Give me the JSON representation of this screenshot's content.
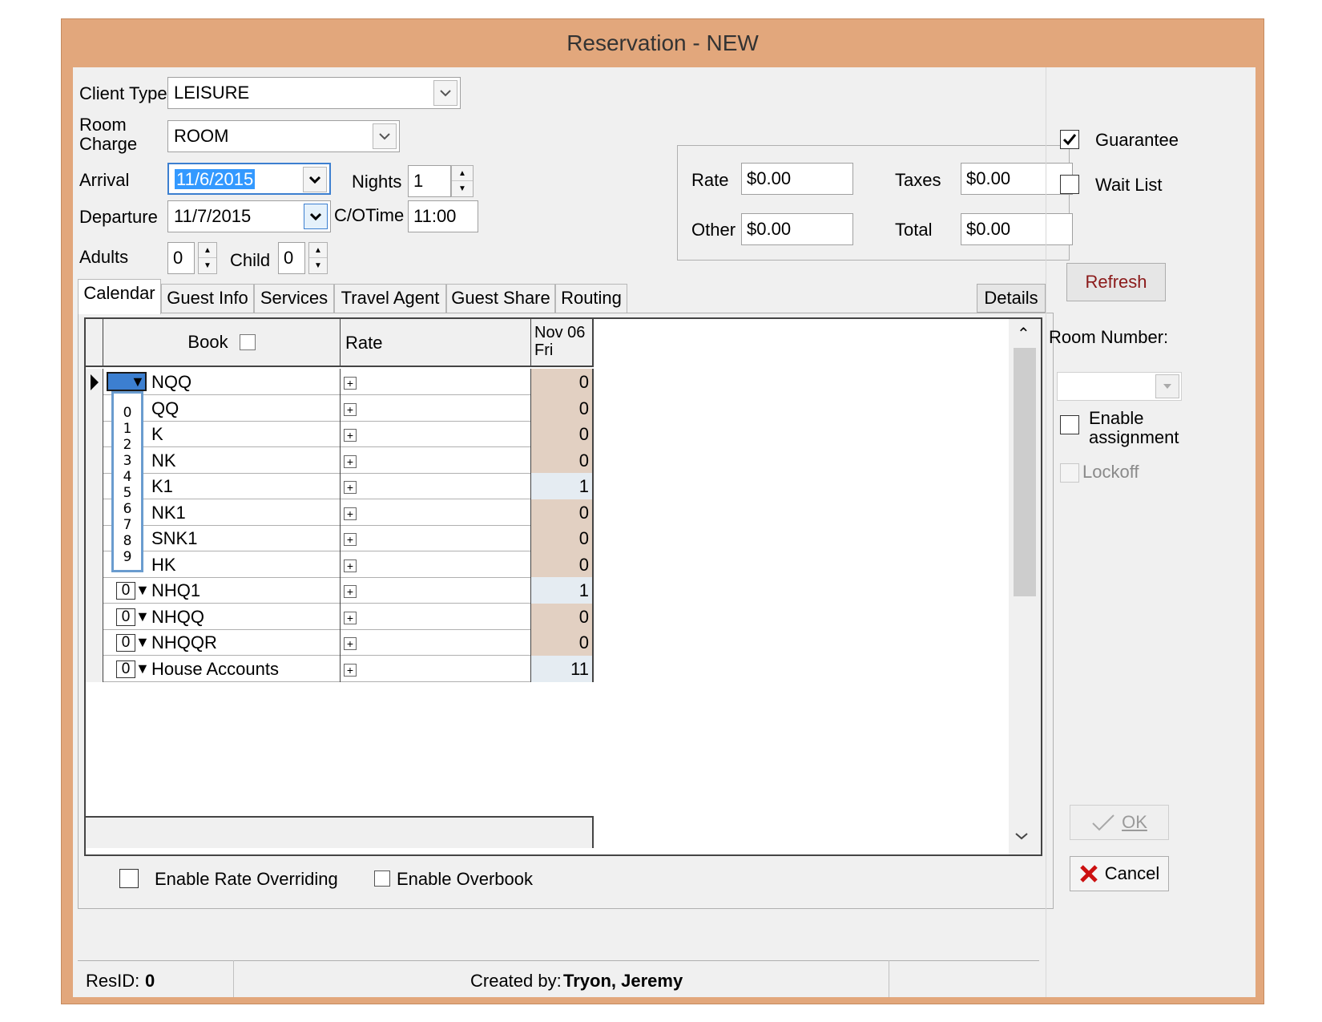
{
  "window": {
    "title": "Reservation - NEW"
  },
  "form": {
    "client_type_label": "Client Type",
    "client_type_value": "LEISURE",
    "room_charge_label_1": "Room",
    "room_charge_label_2": "Charge",
    "room_charge_value": "ROOM",
    "arrival_label": "Arrival",
    "arrival_value": "11/6/2015",
    "nights_label": "Nights",
    "nights_value": "1",
    "departure_label": "Departure",
    "departure_value": "11/7/2015",
    "cotime_label": "C/OTime",
    "cotime_value": "11:00",
    "adults_label": "Adults",
    "adults_value": "0",
    "child_label": "Child",
    "child_value": "0"
  },
  "rates": {
    "rate_label": "Rate",
    "rate_value": "$0.00",
    "taxes_label": "Taxes",
    "taxes_value": "$0.00",
    "other_label": "Other",
    "other_value": "$0.00",
    "total_label": "Total",
    "total_value": "$0.00"
  },
  "side": {
    "guarantee_label": "Guarantee",
    "guarantee_checked": true,
    "waitlist_label": "Wait List",
    "waitlist_checked": false,
    "refresh_label": "Refresh",
    "room_number_label": "Room Number:",
    "enable_assignment_label_1": "Enable",
    "enable_assignment_label_2": "assignment",
    "lockoff_label": "Lockoff",
    "ok_label": "OK",
    "cancel_label": "Cancel"
  },
  "tabs": [
    "Calendar",
    "Guest Info",
    "Services",
    "Travel Agent",
    "Guest Share",
    "Routing"
  ],
  "details_label": "Details",
  "grid": {
    "col_book": "Book",
    "col_rate": "Rate",
    "col_date_1": "Nov 06",
    "col_date_2": "Fri",
    "rows": [
      {
        "name": "NQQ",
        "book": "",
        "avail": "0",
        "open": false
      },
      {
        "name": "QQ",
        "book": "",
        "avail": "0",
        "open": false
      },
      {
        "name": "K",
        "book": "",
        "avail": "0",
        "open": false
      },
      {
        "name": "NK",
        "book": "",
        "avail": "0",
        "open": false
      },
      {
        "name": "K1",
        "book": "",
        "avail": "1",
        "open": true
      },
      {
        "name": "NK1",
        "book": "",
        "avail": "0",
        "open": false
      },
      {
        "name": "SNK1",
        "book": "",
        "avail": "0",
        "open": false
      },
      {
        "name": "HK",
        "book": "",
        "avail": "0",
        "open": false
      },
      {
        "name": "NHQ1",
        "book": "0",
        "avail": "1",
        "open": true
      },
      {
        "name": "NHQQ",
        "book": "0",
        "avail": "0",
        "open": false
      },
      {
        "name": "NHQQR",
        "book": "0",
        "avail": "0",
        "open": false
      },
      {
        "name": "House Accounts",
        "book": "0",
        "avail": "11",
        "open": true
      }
    ],
    "dropdown_options": [
      "0",
      "1",
      "2",
      "3",
      "4",
      "5",
      "6",
      "7",
      "8",
      "9"
    ]
  },
  "options": {
    "rate_override_label": "Enable Rate Overriding",
    "overbook_label": "Enable Overbook"
  },
  "status": {
    "resid_label": "ResID:",
    "resid_value": "0",
    "created_label": "Created by:",
    "created_value": "Tryon, Jeremy"
  },
  "colors": {
    "window_border": "#e2a77c",
    "cell_closed": "#e2d0c2",
    "cell_open": "#e5ecf2",
    "selection": "#3399ff"
  }
}
